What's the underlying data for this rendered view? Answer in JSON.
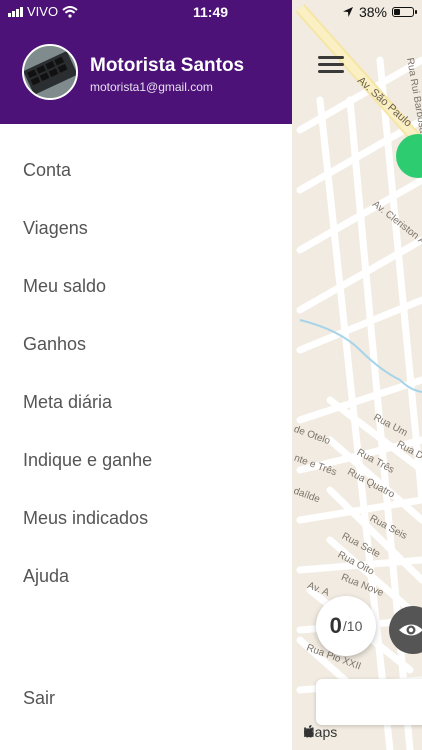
{
  "status_bar": {
    "carrier": "VIVO",
    "time": "11:49",
    "battery": "38%",
    "battery_level": 0.38
  },
  "user": {
    "name": "Motorista Santos",
    "email": "motorista1@gmail.com"
  },
  "menu": {
    "items": [
      {
        "label": "Conta"
      },
      {
        "label": "Viagens"
      },
      {
        "label": "Meu saldo"
      },
      {
        "label": "Ganhos"
      },
      {
        "label": "Meta diária"
      },
      {
        "label": "Indique e ganhe"
      },
      {
        "label": "Meus indicados"
      },
      {
        "label": "Ajuda"
      }
    ],
    "logout": "Sair"
  },
  "map": {
    "streets": {
      "av_sao_paulo": "Av. São Paulo",
      "rua_barbosa": "Rua Rui Barbosa",
      "av_cleriston": "Av. Cleriston Andr",
      "rua_um": "Rua Um",
      "rua_dois": "Rua Dois",
      "rua_tres": "Rua Três",
      "rua_quatro": "Rua Quatro",
      "rua_seis": "Rua Seis",
      "rua_sete": "Rua Sete",
      "rua_oito": "Rua Oito",
      "rua_nove": "Rua Nove",
      "av_a": "Av. A",
      "rua_pio": "Rua Pio XXII",
      "de_otelo": "de Otelo",
      "sete_e_tres": "nte e Três",
      "idalide": "daílde"
    },
    "trip_counter": {
      "count": "0",
      "total": "/10"
    },
    "maps_brand": "Maps"
  }
}
